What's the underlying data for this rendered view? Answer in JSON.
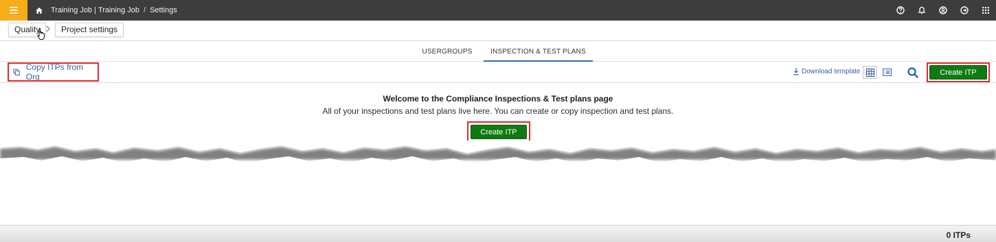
{
  "topbar": {
    "breadcrumb": {
      "project": "Training Job | Training Job",
      "separator": "/",
      "page": "Settings"
    },
    "icons": [
      "menu-icon",
      "home-icon",
      "help-icon",
      "bell-icon",
      "user-icon",
      "logout-icon",
      "apps-grid-icon"
    ]
  },
  "nav": {
    "quality": "Quality",
    "project_settings": "Project settings"
  },
  "tabs": [
    {
      "label": "USERGROUPS",
      "active": false
    },
    {
      "label": "INSPECTION & TEST PLANS",
      "active": true
    }
  ],
  "toolbar": {
    "copy_label": "Copy ITPs from Org",
    "download_label": "Download template",
    "create_label": "Create ITP"
  },
  "welcome": {
    "title": "Welcome to the Compliance Inspections & Test plans page",
    "subtitle": "All of your inspections and test plans live here. You can create or copy inspection and test plans.",
    "create_label": "Create ITP"
  },
  "footer": {
    "count": "0 ITPs"
  },
  "colors": {
    "topbar": "#3d3d3d",
    "menu_accent": "#f6ad1b",
    "primary_button": "#0f7a12",
    "link": "#2f63a8",
    "highlight": "#e3262e"
  }
}
